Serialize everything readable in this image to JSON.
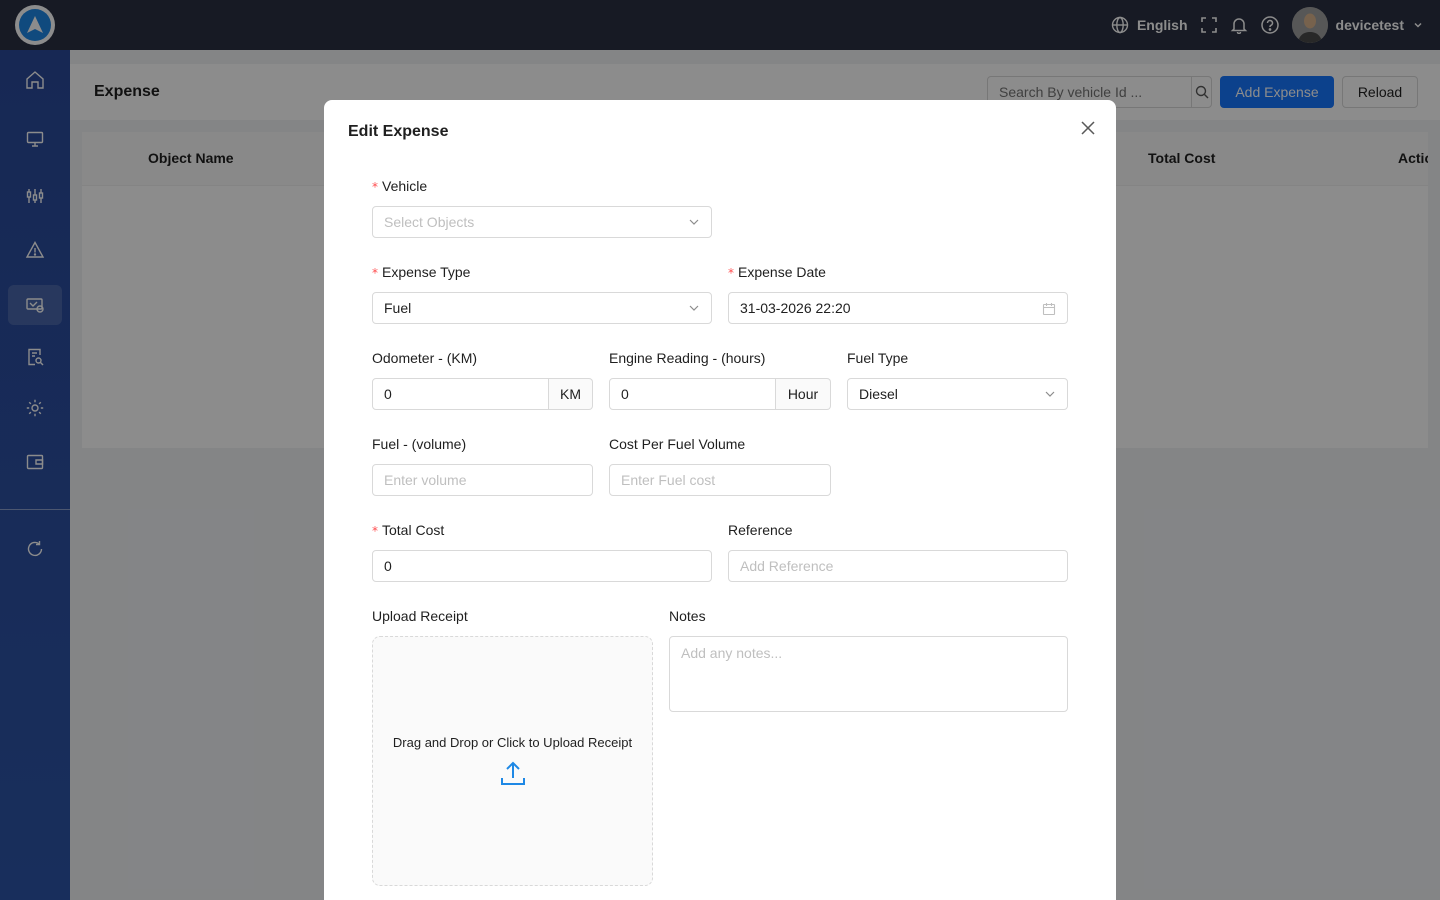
{
  "topbar": {
    "language": "English",
    "username": "devicetest"
  },
  "sidebar": {
    "items": [
      {
        "icon": "home-icon"
      },
      {
        "icon": "monitor-icon"
      },
      {
        "icon": "sliders-icon"
      },
      {
        "icon": "alert-icon"
      },
      {
        "icon": "expense-icon",
        "active": true
      },
      {
        "icon": "report-search-icon"
      },
      {
        "icon": "settings-icon"
      },
      {
        "icon": "wallet-icon"
      },
      {
        "icon": "refresh-icon"
      }
    ]
  },
  "page": {
    "title": "Expense",
    "search_placeholder": "Search By vehicle Id ...",
    "add_button": "Add Expense",
    "reload_button": "Reload",
    "columns": [
      "Object Name",
      "Total Cost",
      "Actio"
    ]
  },
  "modal": {
    "title": "Edit Expense",
    "vehicle": {
      "label": "Vehicle",
      "placeholder": "Select Objects"
    },
    "expense_type": {
      "label": "Expense Type",
      "value": "Fuel"
    },
    "expense_date": {
      "label": "Expense Date",
      "value": "31-03-2026 22:20"
    },
    "odometer": {
      "label": "Odometer - (KM)",
      "value": "0",
      "unit": "KM"
    },
    "engine_reading": {
      "label": "Engine Reading - (hours)",
      "value": "0",
      "unit": "Hour"
    },
    "fuel_type": {
      "label": "Fuel Type",
      "value": "Diesel"
    },
    "fuel_volume": {
      "label": "Fuel - (volume)",
      "placeholder": "Enter volume"
    },
    "cost_per_volume": {
      "label": "Cost Per Fuel Volume",
      "placeholder": "Enter Fuel cost"
    },
    "total_cost": {
      "label": "Total Cost",
      "value": "0"
    },
    "reference": {
      "label": "Reference",
      "placeholder": "Add Reference"
    },
    "upload": {
      "label": "Upload Receipt",
      "text": "Drag and Drop or Click to Upload Receipt"
    },
    "notes": {
      "label": "Notes",
      "placeholder": "Add any notes..."
    }
  },
  "colors": {
    "topbar": "#2b3142",
    "sidebar": "#2c55a8",
    "primary": "#1677ff",
    "required": "#ff4d4f"
  }
}
